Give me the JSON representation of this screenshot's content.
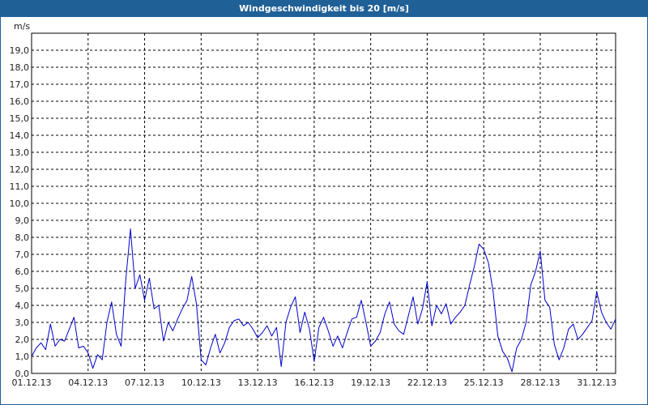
{
  "title": "Windgeschwindigkeit bis 20 [m/s]",
  "colors": {
    "title_bar": "#1f6096",
    "series": "#0000cc",
    "grid": "#000000"
  },
  "chart_data": {
    "type": "line",
    "title": "Windgeschwindigkeit bis 20 [m/s]",
    "ylabel": "m/s",
    "xlabel": "",
    "ylim": [
      0,
      20
    ],
    "xlim": [
      "2013-12-01",
      "2014-01-01"
    ],
    "y_ticks": [
      "0,0",
      "1,0",
      "2,0",
      "3,0",
      "4,0",
      "5,0",
      "6,0",
      "7,0",
      "8,0",
      "9,0",
      "10,0",
      "11,0",
      "12,0",
      "13,0",
      "14,0",
      "15,0",
      "16,0",
      "17,0",
      "18,0",
      "19,0"
    ],
    "x_ticks": [
      "01.12.13",
      "04.12.13",
      "07.12.13",
      "10.12.13",
      "13.12.13",
      "16.12.13",
      "19.12.13",
      "22.12.13",
      "25.12.13",
      "28.12.13",
      "31.12.13"
    ],
    "grid": true,
    "series": [
      {
        "values": [
          {
            "x": "2013-12-01 00:00",
            "y": 1.0
          },
          {
            "x": "2013-12-01 06:00",
            "y": 1.5
          },
          {
            "x": "2013-12-01 12:00",
            "y": 1.8
          },
          {
            "x": "2013-12-01 18:00",
            "y": 1.4
          },
          {
            "x": "2013-12-02 00:00",
            "y": 2.9
          },
          {
            "x": "2013-12-02 06:00",
            "y": 1.6
          },
          {
            "x": "2013-12-02 12:00",
            "y": 2.0
          },
          {
            "x": "2013-12-02 18:00",
            "y": 1.9
          },
          {
            "x": "2013-12-03 00:00",
            "y": 2.6
          },
          {
            "x": "2013-12-03 06:00",
            "y": 3.3
          },
          {
            "x": "2013-12-03 12:00",
            "y": 1.5
          },
          {
            "x": "2013-12-03 18:00",
            "y": 1.6
          },
          {
            "x": "2013-12-04 00:00",
            "y": 1.2
          },
          {
            "x": "2013-12-04 06:00",
            "y": 0.3
          },
          {
            "x": "2013-12-04 12:00",
            "y": 1.1
          },
          {
            "x": "2013-12-04 18:00",
            "y": 0.8
          },
          {
            "x": "2013-12-05 00:00",
            "y": 3.0
          },
          {
            "x": "2013-12-05 06:00",
            "y": 4.2
          },
          {
            "x": "2013-12-05 12:00",
            "y": 2.3
          },
          {
            "x": "2013-12-05 18:00",
            "y": 1.6
          },
          {
            "x": "2013-12-06 00:00",
            "y": 5.5
          },
          {
            "x": "2013-12-06 06:00",
            "y": 8.5
          },
          {
            "x": "2013-12-06 12:00",
            "y": 5.0
          },
          {
            "x": "2013-12-06 18:00",
            "y": 5.8
          },
          {
            "x": "2013-12-07 00:00",
            "y": 4.3
          },
          {
            "x": "2013-12-07 06:00",
            "y": 5.6
          },
          {
            "x": "2013-12-07 12:00",
            "y": 3.8
          },
          {
            "x": "2013-12-07 18:00",
            "y": 4.0
          },
          {
            "x": "2013-12-08 00:00",
            "y": 1.9
          },
          {
            "x": "2013-12-08 06:00",
            "y": 3.0
          },
          {
            "x": "2013-12-08 12:00",
            "y": 2.5
          },
          {
            "x": "2013-12-08 18:00",
            "y": 3.2
          },
          {
            "x": "2013-12-09 00:00",
            "y": 3.8
          },
          {
            "x": "2013-12-09 06:00",
            "y": 4.3
          },
          {
            "x": "2013-12-09 12:00",
            "y": 5.7
          },
          {
            "x": "2013-12-09 18:00",
            "y": 4.1
          },
          {
            "x": "2013-12-10 00:00",
            "y": 0.8
          },
          {
            "x": "2013-12-10 06:00",
            "y": 0.5
          },
          {
            "x": "2013-12-10 12:00",
            "y": 1.5
          },
          {
            "x": "2013-12-10 18:00",
            "y": 2.3
          },
          {
            "x": "2013-12-11 00:00",
            "y": 1.2
          },
          {
            "x": "2013-12-11 06:00",
            "y": 1.8
          },
          {
            "x": "2013-12-11 12:00",
            "y": 2.7
          },
          {
            "x": "2013-12-11 18:00",
            "y": 3.1
          },
          {
            "x": "2013-12-12 00:00",
            "y": 3.2
          },
          {
            "x": "2013-12-12 06:00",
            "y": 2.8
          },
          {
            "x": "2013-12-12 12:00",
            "y": 3.0
          },
          {
            "x": "2013-12-12 18:00",
            "y": 2.6
          },
          {
            "x": "2013-12-13 00:00",
            "y": 2.1
          },
          {
            "x": "2013-12-13 06:00",
            "y": 2.4
          },
          {
            "x": "2013-12-13 12:00",
            "y": 2.8
          },
          {
            "x": "2013-12-13 18:00",
            "y": 2.2
          },
          {
            "x": "2013-12-14 00:00",
            "y": 2.7
          },
          {
            "x": "2013-12-14 06:00",
            "y": 0.4
          },
          {
            "x": "2013-12-14 12:00",
            "y": 3.0
          },
          {
            "x": "2013-12-14 18:00",
            "y": 3.9
          },
          {
            "x": "2013-12-15 00:00",
            "y": 4.5
          },
          {
            "x": "2013-12-15 06:00",
            "y": 2.4
          },
          {
            "x": "2013-12-15 12:00",
            "y": 3.6
          },
          {
            "x": "2013-12-15 18:00",
            "y": 2.6
          },
          {
            "x": "2013-12-16 00:00",
            "y": 0.7
          },
          {
            "x": "2013-12-16 06:00",
            "y": 2.7
          },
          {
            "x": "2013-12-16 12:00",
            "y": 3.3
          },
          {
            "x": "2013-12-16 18:00",
            "y": 2.5
          },
          {
            "x": "2013-12-17 00:00",
            "y": 1.6
          },
          {
            "x": "2013-12-17 06:00",
            "y": 2.2
          },
          {
            "x": "2013-12-17 12:00",
            "y": 1.5
          },
          {
            "x": "2013-12-17 18:00",
            "y": 2.4
          },
          {
            "x": "2013-12-18 00:00",
            "y": 3.2
          },
          {
            "x": "2013-12-18 06:00",
            "y": 3.3
          },
          {
            "x": "2013-12-18 12:00",
            "y": 4.3
          },
          {
            "x": "2013-12-18 18:00",
            "y": 3.0
          },
          {
            "x": "2013-12-19 00:00",
            "y": 1.6
          },
          {
            "x": "2013-12-19 06:00",
            "y": 1.9
          },
          {
            "x": "2013-12-19 12:00",
            "y": 2.4
          },
          {
            "x": "2013-12-19 18:00",
            "y": 3.5
          },
          {
            "x": "2013-12-20 00:00",
            "y": 4.2
          },
          {
            "x": "2013-12-20 06:00",
            "y": 2.9
          },
          {
            "x": "2013-12-20 12:00",
            "y": 2.5
          },
          {
            "x": "2013-12-20 18:00",
            "y": 2.3
          },
          {
            "x": "2013-12-21 00:00",
            "y": 3.4
          },
          {
            "x": "2013-12-21 06:00",
            "y": 4.5
          },
          {
            "x": "2013-12-21 12:00",
            "y": 2.9
          },
          {
            "x": "2013-12-21 18:00",
            "y": 3.8
          },
          {
            "x": "2013-12-22 00:00",
            "y": 5.4
          },
          {
            "x": "2013-12-22 06:00",
            "y": 2.8
          },
          {
            "x": "2013-12-22 12:00",
            "y": 4.0
          },
          {
            "x": "2013-12-22 18:00",
            "y": 3.5
          },
          {
            "x": "2013-12-23 00:00",
            "y": 4.1
          },
          {
            "x": "2013-12-23 06:00",
            "y": 2.9
          },
          {
            "x": "2013-12-23 12:00",
            "y": 3.3
          },
          {
            "x": "2013-12-23 18:00",
            "y": 3.6
          },
          {
            "x": "2013-12-24 00:00",
            "y": 4.0
          },
          {
            "x": "2013-12-24 06:00",
            "y": 5.2
          },
          {
            "x": "2013-12-24 12:00",
            "y": 6.3
          },
          {
            "x": "2013-12-24 18:00",
            "y": 7.6
          },
          {
            "x": "2013-12-25 00:00",
            "y": 7.3
          },
          {
            "x": "2013-12-25 06:00",
            "y": 6.5
          },
          {
            "x": "2013-12-25 12:00",
            "y": 4.8
          },
          {
            "x": "2013-12-25 18:00",
            "y": 2.2
          },
          {
            "x": "2013-12-26 00:00",
            "y": 1.3
          },
          {
            "x": "2013-12-26 06:00",
            "y": 0.9
          },
          {
            "x": "2013-12-26 12:00",
            "y": 0.1
          },
          {
            "x": "2013-12-26 18:00",
            "y": 1.5
          },
          {
            "x": "2013-12-27 00:00",
            "y": 2.0
          },
          {
            "x": "2013-12-27 06:00",
            "y": 3.0
          },
          {
            "x": "2013-12-27 12:00",
            "y": 5.2
          },
          {
            "x": "2013-12-27 18:00",
            "y": 6.0
          },
          {
            "x": "2013-12-28 00:00",
            "y": 7.2
          },
          {
            "x": "2013-12-28 06:00",
            "y": 4.3
          },
          {
            "x": "2013-12-28 12:00",
            "y": 3.9
          },
          {
            "x": "2013-12-28 18:00",
            "y": 1.7
          },
          {
            "x": "2013-12-29 00:00",
            "y": 0.8
          },
          {
            "x": "2013-12-29 06:00",
            "y": 1.5
          },
          {
            "x": "2013-12-29 12:00",
            "y": 2.6
          },
          {
            "x": "2013-12-29 18:00",
            "y": 2.9
          },
          {
            "x": "2013-12-30 00:00",
            "y": 2.0
          },
          {
            "x": "2013-12-30 06:00",
            "y": 2.3
          },
          {
            "x": "2013-12-30 12:00",
            "y": 2.7
          },
          {
            "x": "2013-12-30 18:00",
            "y": 3.1
          },
          {
            "x": "2013-12-31 00:00",
            "y": 4.8
          },
          {
            "x": "2013-12-31 06:00",
            "y": 3.6
          },
          {
            "x": "2013-12-31 12:00",
            "y": 3.0
          },
          {
            "x": "2013-12-31 18:00",
            "y": 2.6
          },
          {
            "x": "2014-01-01 00:00",
            "y": 3.2
          }
        ]
      }
    ]
  }
}
